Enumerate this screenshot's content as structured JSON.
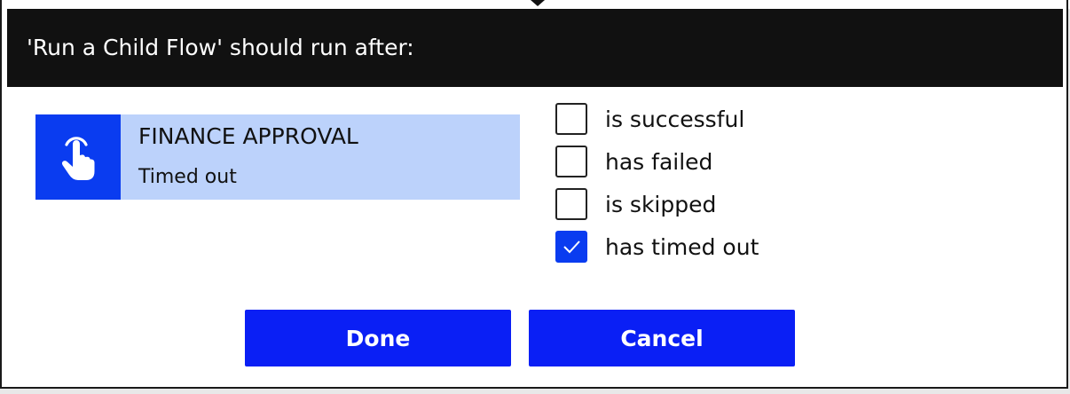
{
  "dialog": {
    "title": "'Run a Child Flow' should run after:"
  },
  "action": {
    "icon": "hand-pointer-icon",
    "name": "FINANCE APPROVAL",
    "status": "Timed out",
    "colors": {
      "icon_bg": "#0a3cf0",
      "card_bg": "#bcd2fb"
    }
  },
  "options": [
    {
      "label": "is successful",
      "checked": false
    },
    {
      "label": "has failed",
      "checked": false
    },
    {
      "label": "is skipped",
      "checked": false
    },
    {
      "label": "has timed out",
      "checked": true
    }
  ],
  "buttons": {
    "done_label": "Done",
    "cancel_label": "Cancel",
    "color": "#0a1ff5"
  }
}
